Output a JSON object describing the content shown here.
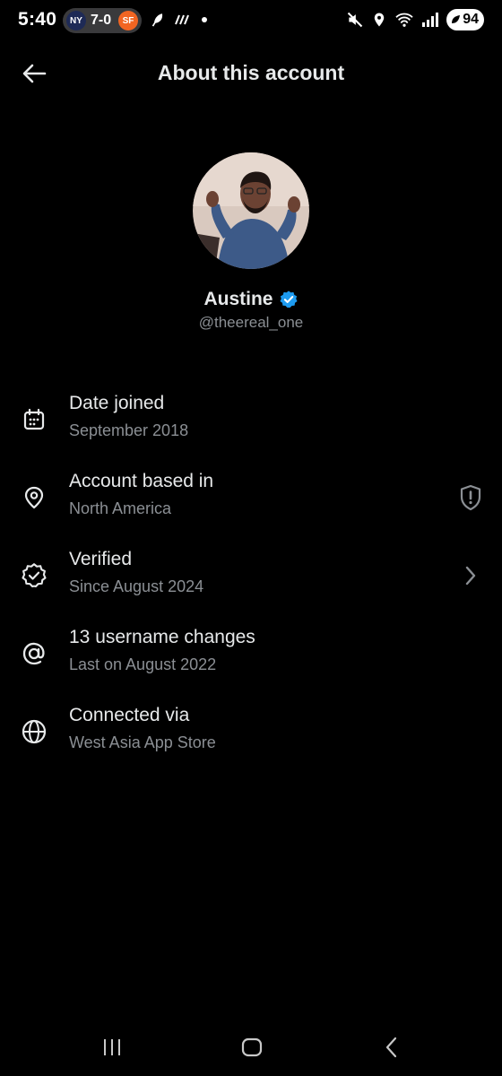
{
  "status_bar": {
    "time": "5:40",
    "score": {
      "home_logo": "NY",
      "text": "7-0",
      "away_logo": "SF"
    },
    "battery": "94",
    "icons": [
      "feather-icon",
      "signal-dash-icon",
      "dot-icon",
      "mute-icon",
      "location-icon",
      "wifi-icon",
      "cellular-icon"
    ]
  },
  "header": {
    "title": "About this account",
    "back_icon": "arrow-left-icon"
  },
  "profile": {
    "name": "Austine",
    "handle": "@theereal_one",
    "verified_badge_color": "#1d9bf0"
  },
  "info_items": [
    {
      "icon": "calendar-icon",
      "label": "Date joined",
      "sub": "September 2018"
    },
    {
      "icon": "location-pin-icon",
      "label": "Account based in",
      "sub": "North America",
      "trailing": "shield-icon"
    },
    {
      "icon": "verified-outline-icon",
      "label": "Verified",
      "sub": "Since August 2024",
      "trailing": "chevron-right-icon"
    },
    {
      "icon": "at-sign-icon",
      "label": "13 username changes",
      "sub": "Last on August 2022"
    },
    {
      "icon": "globe-icon",
      "label": "Connected via",
      "sub": "West Asia App Store"
    }
  ],
  "colors": {
    "background": "#000000",
    "primary_text": "#e7e9ea",
    "secondary_text": "#8b8f94",
    "accent": "#1d9bf0"
  }
}
